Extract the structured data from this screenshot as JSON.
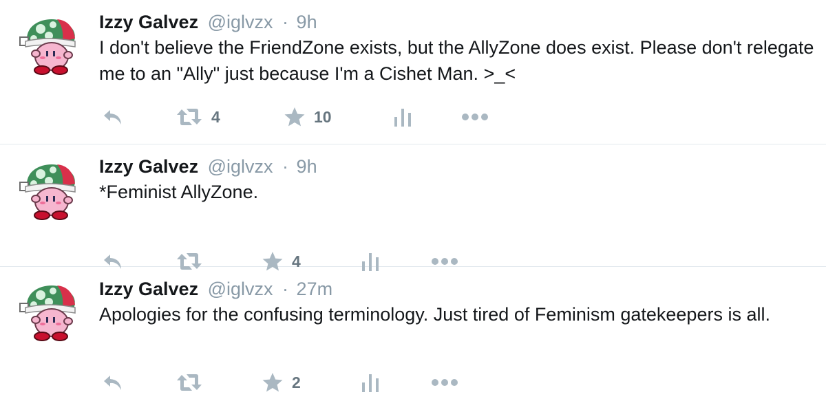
{
  "tweets": [
    {
      "fullname": "Izzy Galvez",
      "username": "@iglvzx",
      "separator": "·",
      "time": "9h",
      "text": "I don't believe the FriendZone exists, but the AllyZone does exist. Please don't relegate me to an \"Ally\" just because I'm a Cishet Man. >_<",
      "retweets": "4",
      "likes": "10"
    },
    {
      "fullname": "Izzy Galvez",
      "username": "@iglvzx",
      "separator": "·",
      "time": "9h",
      "text": "*Feminist AllyZone.",
      "retweets": "",
      "likes": "4"
    },
    {
      "fullname": "Izzy Galvez",
      "username": "@iglvzx",
      "separator": "·",
      "time": "27m",
      "text": "Apologies for the confusing terminology. Just tired of Feminism gatekeepers is all.",
      "retweets": "",
      "likes": "2"
    }
  ],
  "icons": {
    "avatar": "kirby-mushroom-hat-avatar",
    "reply": "reply-icon",
    "retweet": "retweet-icon",
    "like": "star-icon",
    "analytics": "analytics-icon",
    "more": "more-icon"
  },
  "colors": {
    "icon": "#aab8c2",
    "text": "#14171a",
    "secondary": "#8899a6",
    "border": "#e1e8ed"
  }
}
